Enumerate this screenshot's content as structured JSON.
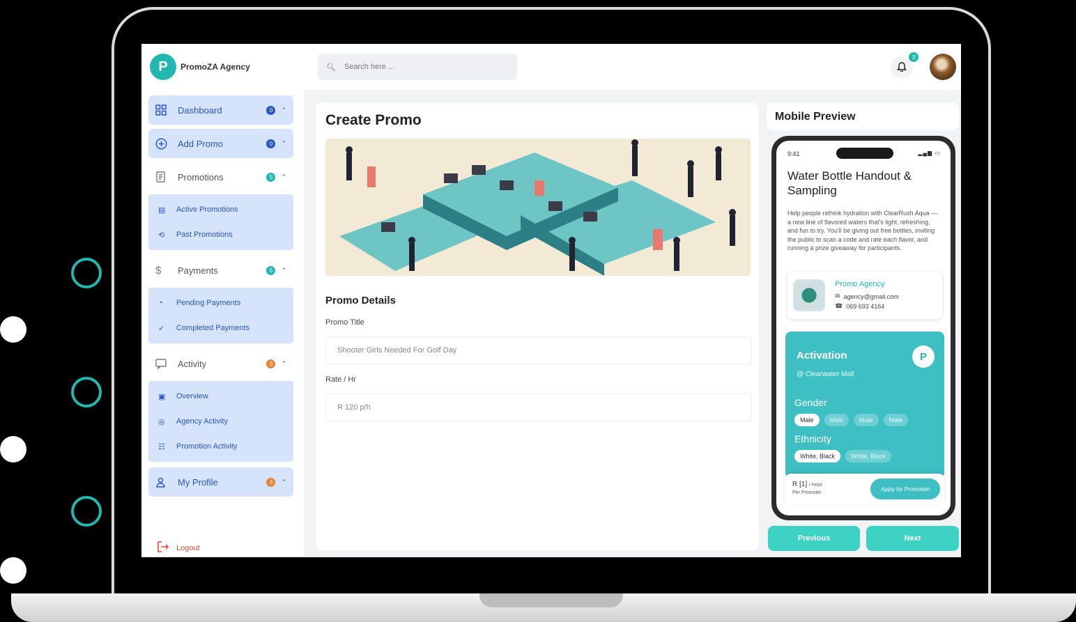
{
  "brand": {
    "name": "PromoZA Agency",
    "logo_letter": "P"
  },
  "sidebar": {
    "items": [
      {
        "label": "Dashboard",
        "icon": "grid-icon",
        "badge": "0",
        "badge_color": "#2a55c4",
        "active": true
      },
      {
        "label": "Add Promo",
        "icon": "plus-circle-icon",
        "badge": "0",
        "badge_color": "#2a55c4",
        "active": true
      },
      {
        "label": "Promotions",
        "icon": "document-icon",
        "badge": "5",
        "badge_color": "#22b8b0",
        "active": false
      },
      {
        "label": "Payments",
        "icon": "dollar-icon",
        "badge": "5",
        "badge_color": "#22b8b0",
        "active": false
      },
      {
        "label": "Activity",
        "icon": "chat-icon",
        "badge": "3",
        "badge_color": "#e8833a",
        "active": false
      },
      {
        "label": "My Profile",
        "icon": "user-icon",
        "badge": "3",
        "badge_color": "#e8833a",
        "active": true
      }
    ],
    "promotions_sub": [
      "Active Promotions",
      "Past Promotions"
    ],
    "payments_sub": [
      "Pending Payments",
      "Completed Payments"
    ],
    "activity_sub": [
      "Overview",
      "Agency Activity",
      "Promotion Activity"
    ],
    "logout": "Logout"
  },
  "topbar": {
    "search_placeholder": "Search here ...",
    "notifications_count": "3"
  },
  "create_promo": {
    "title": "Create Promo",
    "section": "Promo Details",
    "fields": [
      {
        "label": "Promo Title",
        "value": "Shooter Girls Needed For Golf Day"
      },
      {
        "label": "Rate / Hr",
        "value": "R 120 p/h"
      }
    ]
  },
  "mobile_preview": {
    "header": "Mobile Preview",
    "status_time": "9:41",
    "promo_title": "Water Bottle Handout & Sampling",
    "description": "Help people rethink hydration with ClearRush Aqua — a new line of flavored waters that's light, refreshing, and fun to try. You'll be giving out free bottles, inviting the public to scan a code and rate each flavor, and running a prize giveaway for participants.",
    "agency": {
      "name": "Promo Agency",
      "email": "agency@gmail.com",
      "phone": "069 693 4164"
    },
    "activation": {
      "title": "Activation",
      "location": "@ Clearwater Mall",
      "gender_label": "Gender",
      "gender_options": [
        "Male",
        "Male",
        "Male",
        "Male"
      ],
      "ethnicity_label": "Ethnicity",
      "ethnicity_options": [
        "White, Black",
        "White, Black"
      ]
    },
    "rate": {
      "value": "R [1]",
      "unit": "/ Hour",
      "sub": "Per Promoter"
    },
    "apply_label": "Apply for Promotion"
  },
  "footer_buttons": {
    "previous": "Previous",
    "next": "Next"
  },
  "colors": {
    "accent": "#22b8b0",
    "active_nav": "#d6e4fb",
    "logout": "#e74c3c"
  }
}
